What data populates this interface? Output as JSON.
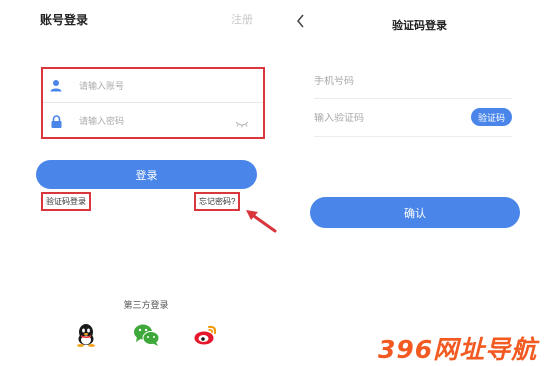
{
  "login": {
    "title": "账号登录",
    "register_label": "注册",
    "account_placeholder": "请输入账号",
    "password_placeholder": "请输入密码",
    "login_button": "登录",
    "sms_login_label": "验证码登录",
    "forgot_password_label": "忘记密码?",
    "third_party_title": "第三方登录",
    "social_icons": [
      "qq-icon",
      "wechat-icon",
      "weibo-icon"
    ]
  },
  "sms_login": {
    "title": "验证码登录",
    "phone_placeholder": "手机号码",
    "code_placeholder": "输入验证码",
    "get_code_button": "验证码",
    "confirm_button": "确认"
  },
  "colors": {
    "accent": "#4a86ea",
    "highlight": "#d9363e",
    "watermark": "#f25a22"
  },
  "watermark_text": "396网址导航"
}
